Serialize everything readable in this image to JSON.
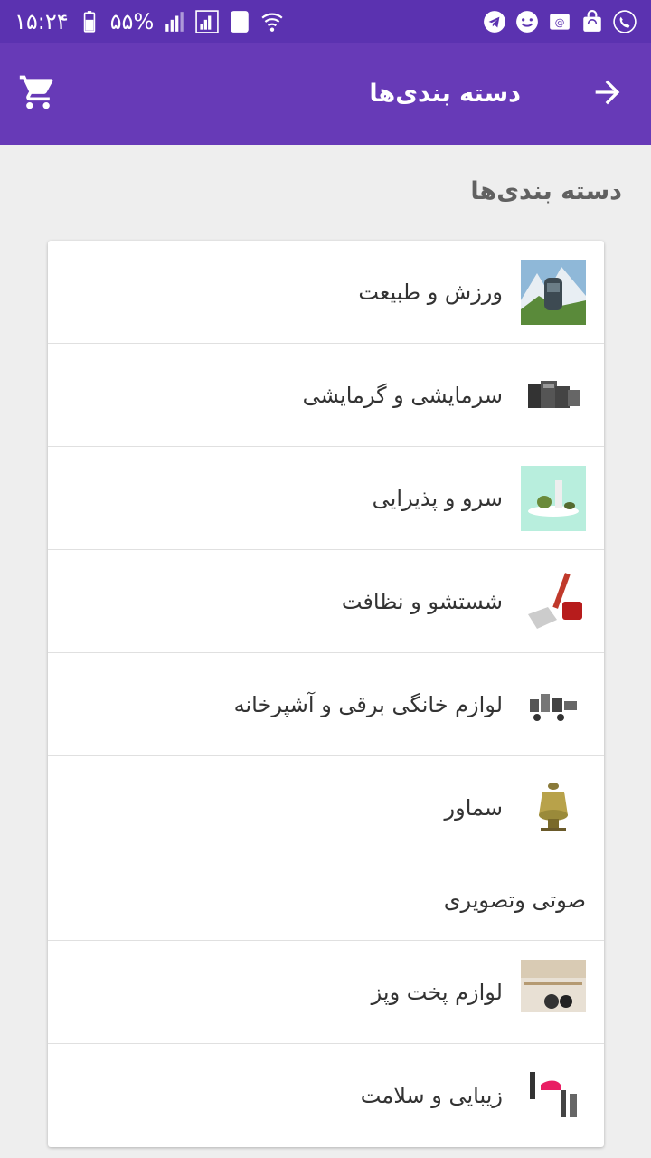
{
  "status_bar": {
    "time": "۱۵:۲۴",
    "battery": "۵۵%",
    "sim_label": "1"
  },
  "app_bar": {
    "title": "دسته بندی‌ها",
    "back_icon": "arrow-forward-icon",
    "cart_icon": "shopping-cart-icon"
  },
  "section": {
    "title": "دسته بندی‌ها"
  },
  "categories": [
    {
      "label": "ورزش و طبیعت",
      "thumb": "mountain-backpack"
    },
    {
      "label": "سرمایشی و گرمایشی",
      "thumb": "heaters"
    },
    {
      "label": "سرو و پذیرایی",
      "thumb": "serving-set"
    },
    {
      "label": "شستشو و نظافت",
      "thumb": "steam-mop"
    },
    {
      "label": "لوازم خانگی برقی و آشپرخانه",
      "thumb": "kitchen-appliances"
    },
    {
      "label": "سماور",
      "thumb": "samovar"
    },
    {
      "label": "صوتی وتصویری",
      "thumb": ""
    },
    {
      "label": "لوازم پخت وپز",
      "thumb": "cookware"
    },
    {
      "label": "زیبایی و سلامت",
      "thumb": "hair-tools"
    }
  ],
  "colors": {
    "status_bar": "#5b32b0",
    "app_bar": "#673ab7",
    "background": "#eeeeee"
  }
}
